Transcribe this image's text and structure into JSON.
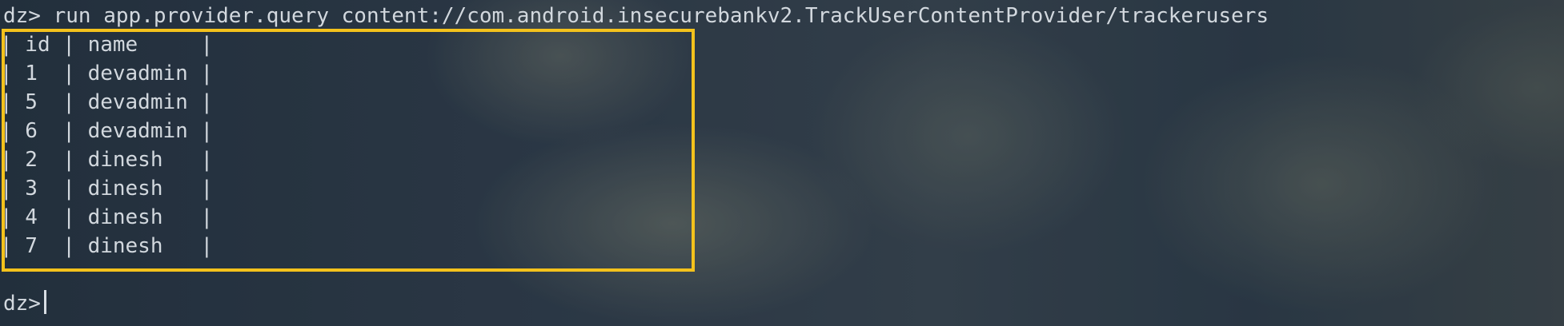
{
  "terminal": {
    "command": {
      "prompt": "dz>",
      "text": " run app.provider.query content://com.android.insecurebankv2.TrackUserContentProvider/trackerusers"
    },
    "table": {
      "header": {
        "id": "| id | name     |",
        "name": ""
      },
      "rows": [
        "| 1  | devadmin |",
        "| 5  | devadmin |",
        "| 6  | devadmin |",
        "| 2  | dinesh   |",
        "| 3  | dinesh   |",
        "| 4  | dinesh   |",
        "| 7  | dinesh   |"
      ]
    },
    "next_prompt": {
      "prompt": "dz>"
    }
  },
  "highlight": {
    "color": "#f4c21c"
  }
}
